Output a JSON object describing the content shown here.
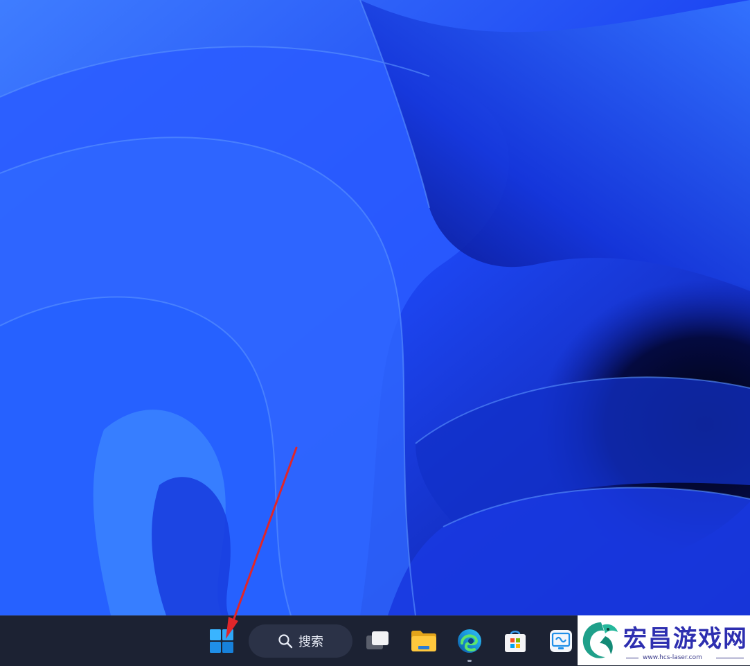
{
  "desktop": {
    "wallpaper": "windows-11-bloom-wallpaper",
    "colors": {
      "deep": "#02041e",
      "mid": "#1b3df0",
      "light": "#3d7bff"
    }
  },
  "taskbar": {
    "search": {
      "label": "搜索",
      "icon": "search-icon"
    },
    "items": [
      {
        "name": "start-button",
        "icon": "windows-logo-icon"
      },
      {
        "name": "task-view-button",
        "icon": "task-view-icon"
      },
      {
        "name": "file-explorer-button",
        "icon": "folder-icon"
      },
      {
        "name": "edge-button",
        "icon": "edge-icon",
        "running": true
      },
      {
        "name": "microsoft-store-button",
        "icon": "store-icon"
      },
      {
        "name": "remote-app-button",
        "icon": "remote-app-icon"
      }
    ],
    "colors": {
      "background": "#1c2233",
      "search_bg": "#2b3247"
    }
  },
  "annotation": {
    "type": "arrow",
    "color": "#e0262a",
    "target": "start-button"
  },
  "watermark": {
    "title": "宏昌游戏网",
    "url": "www.hcs-laser.com",
    "color": "#2e2fb0"
  }
}
